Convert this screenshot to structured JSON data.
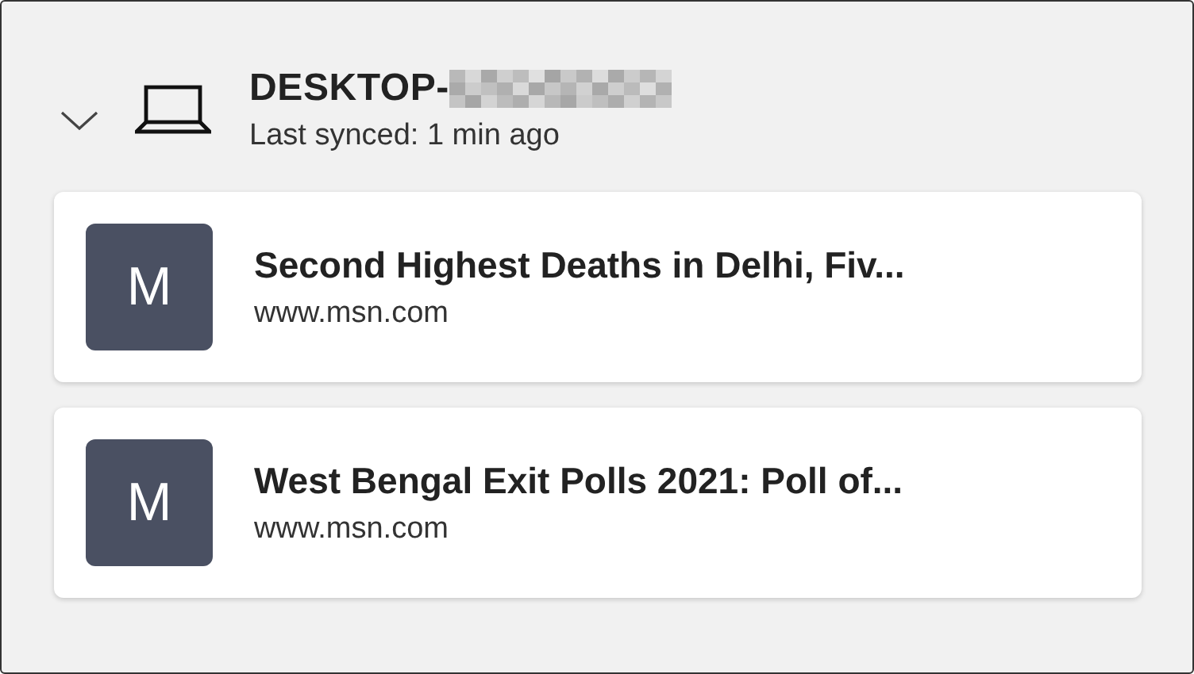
{
  "device": {
    "name": "DESKTOP-",
    "expanded": true,
    "last_synced": "Last synced: 1 min ago"
  },
  "tabs": [
    {
      "icon_letter": "M",
      "title": "Second Highest Deaths in Delhi, Fiv...",
      "url": "www.msn.com"
    },
    {
      "icon_letter": "M",
      "title": "West Bengal Exit Polls 2021: Poll of...",
      "url": "www.msn.com"
    }
  ]
}
